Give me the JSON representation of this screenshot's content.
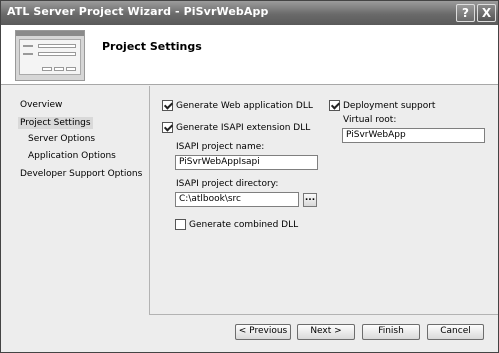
{
  "window": {
    "title": "ATL Server Project Wizard - PiSvrWebApp",
    "help_glyph": "?",
    "close_glyph": "X"
  },
  "header": {
    "title": "Project Settings"
  },
  "sidebar": {
    "items": [
      {
        "label": "Overview",
        "selected": false
      },
      {
        "label": "Project Settings",
        "selected": true
      },
      {
        "label": "Server Options",
        "selected": false
      },
      {
        "label": "Application Options",
        "selected": false
      },
      {
        "label": "Developer Support Options",
        "selected": false
      }
    ]
  },
  "settings": {
    "generate_web_dll": {
      "label": "Generate Web application DLL",
      "checked": true
    },
    "generate_isapi_dll": {
      "label": "Generate ISAPI extension DLL",
      "checked": true
    },
    "isapi_name": {
      "label": "ISAPI project name:",
      "value": "PiSvrWebAppIsapi"
    },
    "isapi_directory": {
      "label": "ISAPI project directory:",
      "value": "C:\\atlbook\\src",
      "browse_label": "..."
    },
    "generate_combined_dll": {
      "label": "Generate combined DLL",
      "checked": false
    },
    "deployment_support": {
      "label": "Deployment support",
      "checked": true
    },
    "virtual_root": {
      "label": "Virtual root:",
      "value": "PiSvrWebApp"
    }
  },
  "buttons": {
    "previous": "< Previous",
    "next": "Next >",
    "finish": "Finish",
    "cancel": "Cancel"
  }
}
